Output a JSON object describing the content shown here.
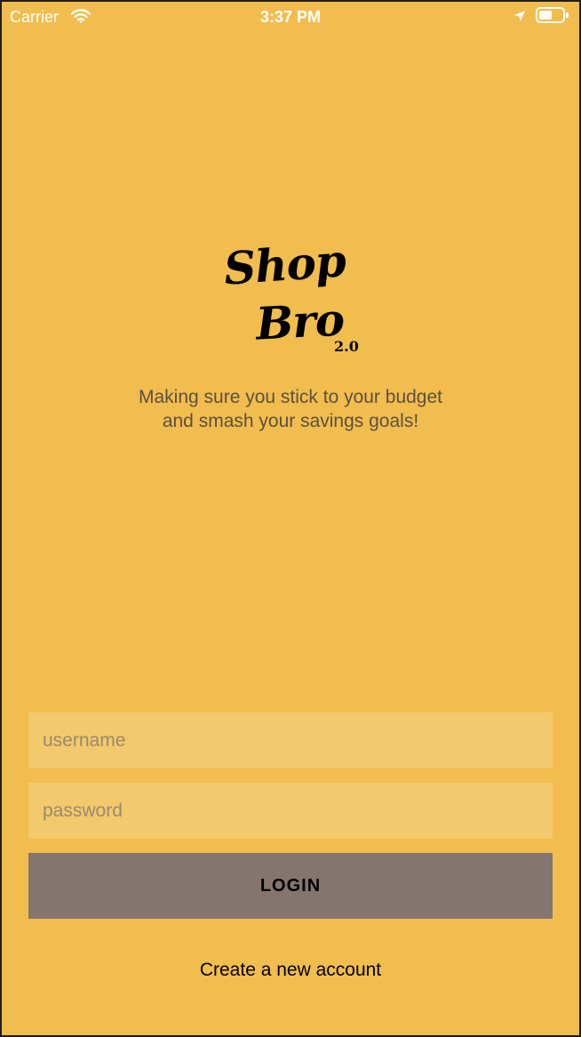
{
  "status_bar": {
    "carrier": "Carrier",
    "time": "3:37 PM",
    "icons": [
      "wifi-icon",
      "location-icon",
      "battery-icon"
    ]
  },
  "logo": {
    "line1": "Shop",
    "line2": "Bro",
    "version": "2.0"
  },
  "tagline": "Making sure you stick to your budget and smash your savings goals!",
  "login_form": {
    "username_placeholder": "username",
    "password_placeholder": "password",
    "login_label": "LOGIN"
  },
  "create_account_link": "Create a new account",
  "colors": {
    "background": "#f1bd4e",
    "field_background": "#f2c96c",
    "button_background": "#84766f",
    "tagline_text": "#5c5040"
  }
}
